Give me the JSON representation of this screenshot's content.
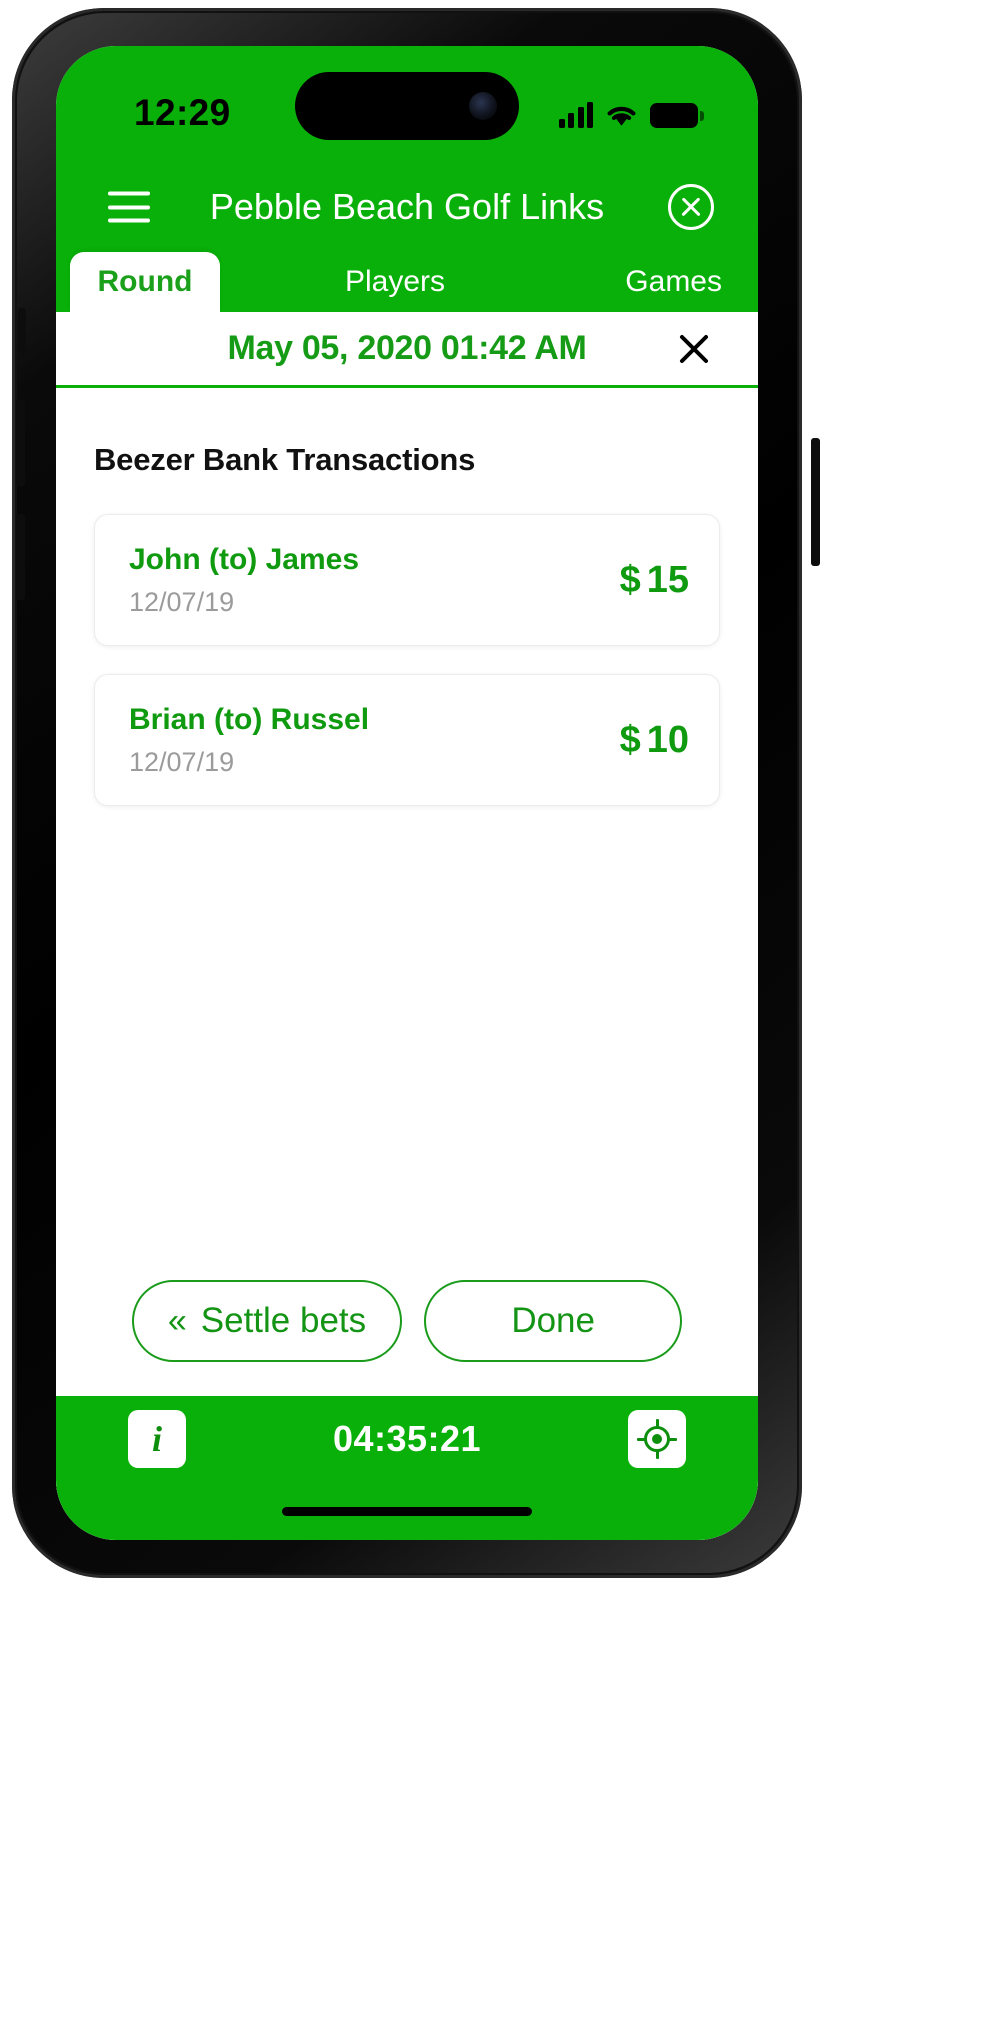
{
  "theme": {
    "brand_green": "#09b009",
    "text_green": "#0f9a0f",
    "muted_grey": "#9b9b9b",
    "title_black": "#111111"
  },
  "status_bar": {
    "time": "12:29",
    "signal_icon": "cellular-signal-icon",
    "wifi_icon": "wifi-icon",
    "battery_icon": "battery-icon"
  },
  "nav": {
    "menu_icon": "hamburger-menu-icon",
    "title": "Pebble Beach Golf Links",
    "close_icon": "circle-close-icon"
  },
  "tabs": [
    {
      "label": "Round",
      "active": true
    },
    {
      "label": "Players",
      "active": false
    },
    {
      "label": "Games",
      "active": false
    }
  ],
  "date_bar": {
    "date_time": "May 05, 2020  01:42 AM",
    "close_icon": "close-x-icon"
  },
  "main": {
    "section_title": "Beezer Bank Transactions",
    "transactions": [
      {
        "parties": "John  (to)  James",
        "date": "12/07/19",
        "currency": "$",
        "amount": "15"
      },
      {
        "parties": "Brian  (to) Russel",
        "date": "12/07/19",
        "currency": "$",
        "amount": "10"
      }
    ]
  },
  "actions": {
    "settle_chevron": "«",
    "settle_label": "Settle bets",
    "done_label": "Done"
  },
  "footer": {
    "info_icon_label": "i",
    "info_icon": "info-icon",
    "timer": "04:35:21",
    "gps_icon": "gps-crosshair-icon"
  }
}
